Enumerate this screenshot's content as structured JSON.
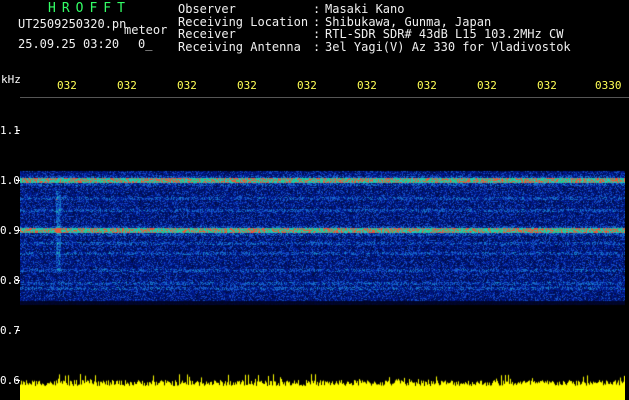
{
  "header": {
    "title": "HROFFT",
    "filename": "UT2509250320.pn",
    "meteor_label": "meteor",
    "datetime": "25.09.25 03:20",
    "extra": "0_"
  },
  "info": [
    {
      "key": "Observer",
      "value": "Masaki Kano"
    },
    {
      "key": "Receiving Location",
      "value": "Shibukawa, Gunma, Japan"
    },
    {
      "key": "Receiver",
      "value": "RTL-SDR SDR# 43dB L15 103.2MHz CW"
    },
    {
      "key": "Receiving Antenna",
      "value": "3el Yagi(V) Az 330 for Vladivostok"
    }
  ],
  "axis": {
    "unit": "kHz",
    "y_ticks": [
      {
        "label": "1.1",
        "value": 1.1
      },
      {
        "label": "1.0",
        "value": 1.0
      },
      {
        "label": "0.9",
        "value": 0.9
      },
      {
        "label": "0.8",
        "value": 0.8
      },
      {
        "label": "0.7",
        "value": 0.7
      },
      {
        "label": "0.6",
        "value": 0.6
      }
    ],
    "x_ticks": [
      "032",
      "032",
      "032",
      "032",
      "032",
      "032",
      "032",
      "032",
      "032",
      "0330"
    ],
    "y_range": [
      0.6,
      1.2
    ]
  },
  "colors": {
    "background": "#000000",
    "axis_text": "#ffffff",
    "time_labels": "#ffff55",
    "title": "#33ff66",
    "signal_bar": "#ffff00",
    "noise_low": "#000a3c",
    "noise_mid": "#1e46c8",
    "noise_high": "#23c8c8",
    "line_green": "#3cff50",
    "line_peak": "#ff3c3c"
  },
  "spectrogram": {
    "band_top_khz": 1.02,
    "band_bottom_khz": 0.76,
    "carrier_lines_khz": [
      1.0,
      0.9
    ]
  }
}
